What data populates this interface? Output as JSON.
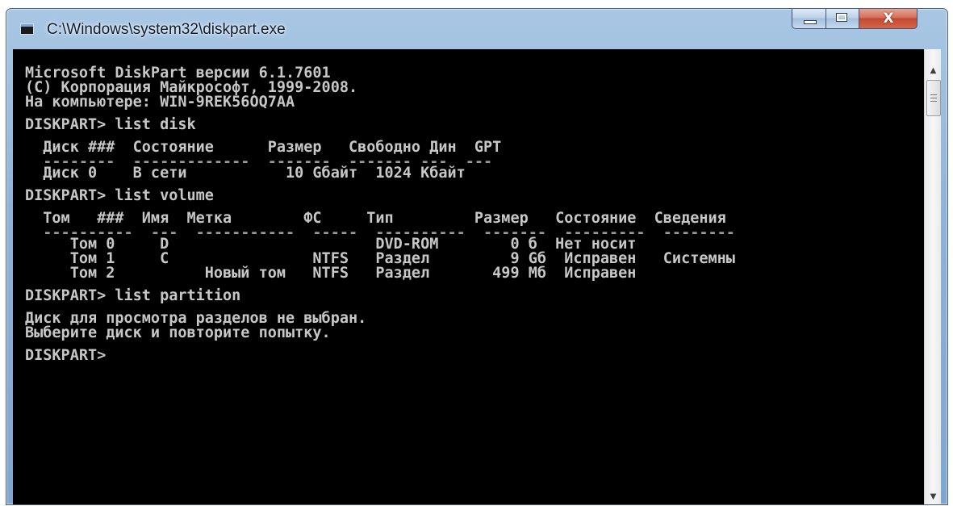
{
  "window": {
    "title": "C:\\Windows\\system32\\diskpart.exe",
    "close_glyph": "X",
    "icons": [
      "console-app-icon",
      "minimize-icon",
      "maximize-icon",
      "close-icon"
    ]
  },
  "colors": {
    "console_background": "#000000",
    "console_text": "#c7c7c7",
    "title_bar": "#8fb3d8",
    "close_button": "#c24a30"
  },
  "console": {
    "lines": [
      "Microsoft DiskPart версии 6.1.7601",
      "(C) Корпорация Майкрософт, 1999-2008.",
      "На компьютере: WIN-9REK56OQ7AA",
      "",
      "DISKPART> list disk",
      "",
      "  Диск ###  Состояние      Размер   Свободно Дин  GPT",
      "  --------  -------------  -------  ------- ---  ---",
      "  Диск 0    В сети           10 Gбайт  1024 Kбайт",
      "",
      "DISKPART> list volume",
      "",
      "  Том   ###  Имя  Метка        ФС     Тип         Размер   Состояние  Сведения",
      "  ----------  ---  -----------  -----  ----------  -------  ---------  --------",
      "     Том 0     D                       DVD-ROM        0 б  Нет носит",
      "     Том 1     C                NTFS   Раздел         9 Gб  Исправен   Системны",
      "     Том 2          Новый том   NTFS   Раздел       499 Mб  Исправен",
      "",
      "DISKPART> list partition",
      "",
      "Диск для просмотра разделов не выбран.",
      "Выберите диск и повторите попытку.",
      "",
      "DISKPART>"
    ]
  },
  "scrollbar": {
    "up_arrow": "▲",
    "down_arrow": "▼"
  }
}
